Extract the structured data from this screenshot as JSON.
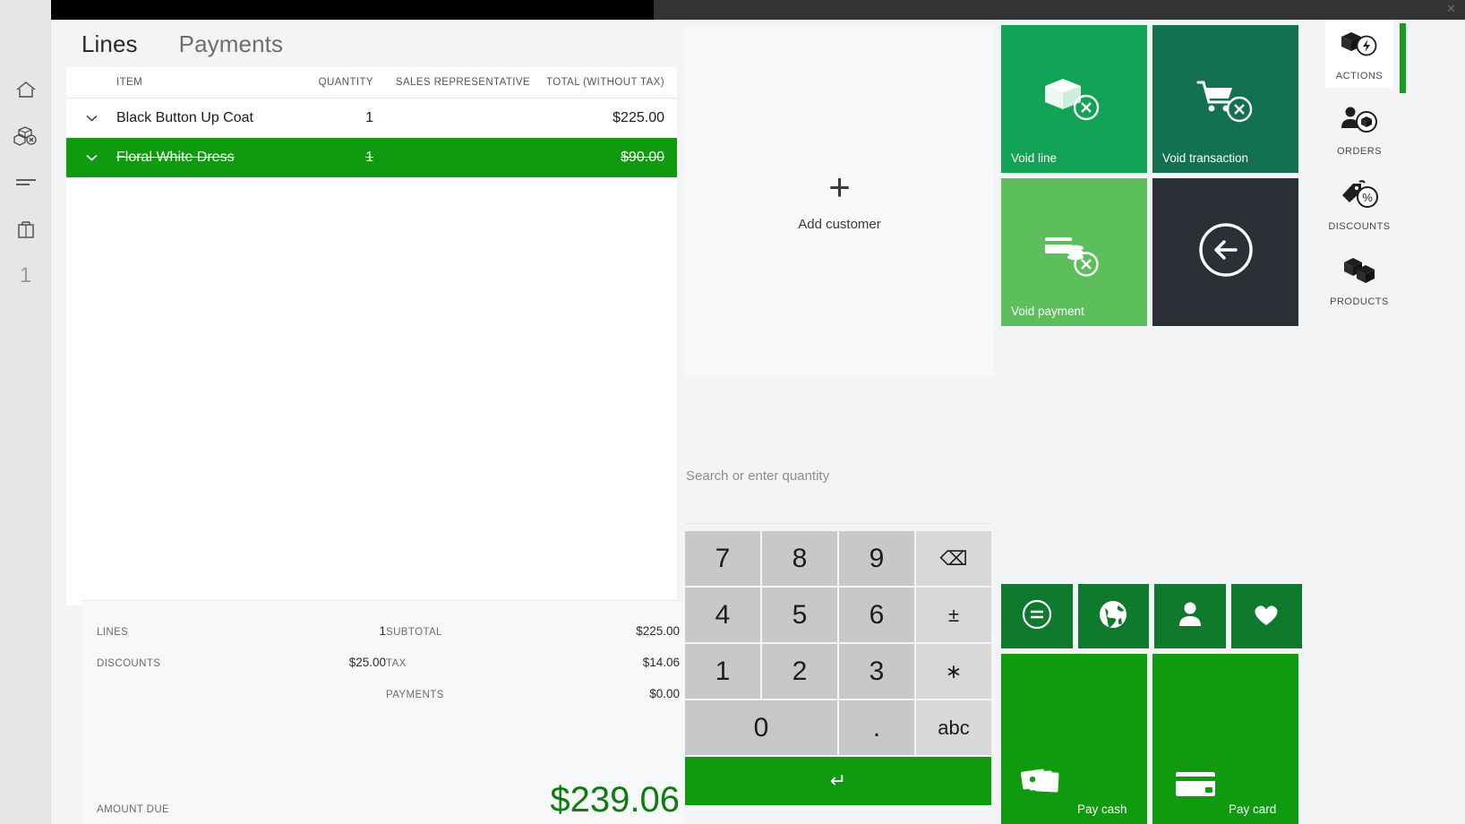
{
  "window": {
    "close_label": "✕"
  },
  "left_rail": {
    "items": [
      {
        "name": "home-icon",
        "label": ""
      },
      {
        "name": "products-icon",
        "label": ""
      },
      {
        "name": "lines-icon",
        "label": ""
      },
      {
        "name": "bag-icon",
        "label": ""
      }
    ],
    "count": "1"
  },
  "cart": {
    "tabs": [
      {
        "label": "Lines",
        "active": true
      },
      {
        "label": "Payments",
        "active": false
      }
    ],
    "columns": {
      "item": "ITEM",
      "quantity": "QUANTITY",
      "sales_representative": "SALES REPRESENTATIVE",
      "total": "TOTAL (WITHOUT TAX)"
    },
    "rows": [
      {
        "item": "Black Button Up Coat",
        "quantity": "1",
        "sales_representative": "",
        "total": "$225.00",
        "selected": false,
        "voided": false
      },
      {
        "item": "Floral White Dress",
        "quantity": "1",
        "sales_representative": "",
        "total": "$90.00",
        "selected": true,
        "voided": true
      }
    ],
    "totals": {
      "lines_label": "LINES",
      "lines_value": "1",
      "discounts_label": "DISCOUNTS",
      "discounts_value": "$25.00",
      "subtotal_label": "SUBTOTAL",
      "subtotal_value": "$225.00",
      "tax_label": "TAX",
      "tax_value": "$14.06",
      "payments_label": "PAYMENTS",
      "payments_value": "$0.00",
      "amount_due_label": "AMOUNT DUE",
      "amount_due_value": "$239.06"
    }
  },
  "customer": {
    "add_label": "Add customer",
    "plus_glyph": "+"
  },
  "search": {
    "placeholder": "Search or enter quantity",
    "value": ""
  },
  "keypad": {
    "keys": [
      {
        "label": "7",
        "type": "digit"
      },
      {
        "label": "8",
        "type": "digit"
      },
      {
        "label": "9",
        "type": "digit"
      },
      {
        "label": "⌫",
        "type": "fn",
        "name": "backspace-key"
      },
      {
        "label": "4",
        "type": "digit"
      },
      {
        "label": "5",
        "type": "digit"
      },
      {
        "label": "6",
        "type": "digit"
      },
      {
        "label": "±",
        "type": "fn",
        "name": "plus-minus-key"
      },
      {
        "label": "1",
        "type": "digit"
      },
      {
        "label": "2",
        "type": "digit"
      },
      {
        "label": "3",
        "type": "digit"
      },
      {
        "label": "∗",
        "type": "fn",
        "name": "asterisk-key"
      },
      {
        "label": "0",
        "type": "zero"
      },
      {
        "label": ".",
        "type": "digit"
      },
      {
        "label": "abc",
        "type": "fn",
        "name": "abc-key"
      }
    ],
    "enter_label": "↵"
  },
  "tiles": {
    "void_line": {
      "label": "Void line",
      "color": "#12a356",
      "icon": "void-package-icon"
    },
    "void_transaction": {
      "label": "Void transaction",
      "color": "#14714f",
      "icon": "void-cart-icon"
    },
    "void_payment": {
      "label": "Void payment",
      "color": "#5cbf5c",
      "icon": "void-payment-icon"
    },
    "back": {
      "label": "",
      "color": "#2b2f36",
      "icon": "back-arrow-icon"
    },
    "small": [
      {
        "name": "equals-tile",
        "icon": "equals-circle-icon",
        "color": "#0f7a2e"
      },
      {
        "name": "globe-tile",
        "icon": "globe-icon",
        "color": "#0f7a2e"
      },
      {
        "name": "person-tile",
        "icon": "person-icon",
        "color": "#0f7a2e"
      },
      {
        "name": "favorite-tile",
        "icon": "heart-icon",
        "color": "#0f7a2e"
      }
    ],
    "pay_cash": {
      "label": "Pay cash",
      "color": "#0f9a0f",
      "icon": "cash-icon"
    },
    "pay_card": {
      "label": "Pay card",
      "color": "#0f9a0f",
      "icon": "card-icon"
    }
  },
  "right_rail": {
    "items": [
      {
        "label": "ACTIONS",
        "icon": "actions-icon",
        "active": true
      },
      {
        "label": "ORDERS",
        "icon": "orders-icon",
        "active": false
      },
      {
        "label": "DISCOUNTS",
        "icon": "discounts-icon",
        "active": false
      },
      {
        "label": "PRODUCTS",
        "icon": "products-icon",
        "active": false
      }
    ],
    "accent_color": "#14a01c"
  }
}
